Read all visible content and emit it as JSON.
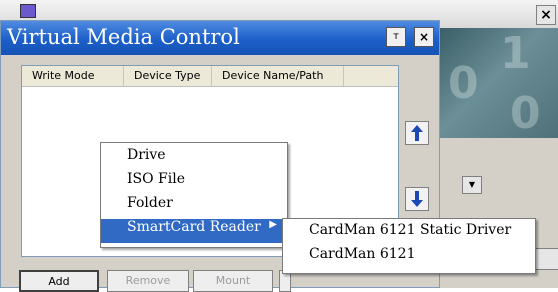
{
  "background_window": {
    "close_glyph": "×"
  },
  "dialog": {
    "title": "Virtual Media Control",
    "pin_glyph": "ᴛ",
    "close_glyph": "×",
    "columns": [
      "Write Mode",
      "Device Type",
      "Device Name/Path"
    ],
    "buttons": {
      "add": "Add",
      "remove": "Remove",
      "mount": "Mount"
    },
    "side_buttons": {
      "up_icon": "arrow-up-icon",
      "down_icon": "arrow-down-icon"
    }
  },
  "context_menu": {
    "items": [
      "Drive",
      "ISO File",
      "Folder",
      "SmartCard Reader"
    ],
    "selected_index": 3,
    "submenu_arrow": "▶",
    "submenu": [
      "CardMan 6121 Static Driver",
      "CardMan 6121"
    ]
  },
  "colors": {
    "title_bar": "#1c5fc9",
    "selection": "#316ac5",
    "arrow_icons": "#1b48b5"
  }
}
